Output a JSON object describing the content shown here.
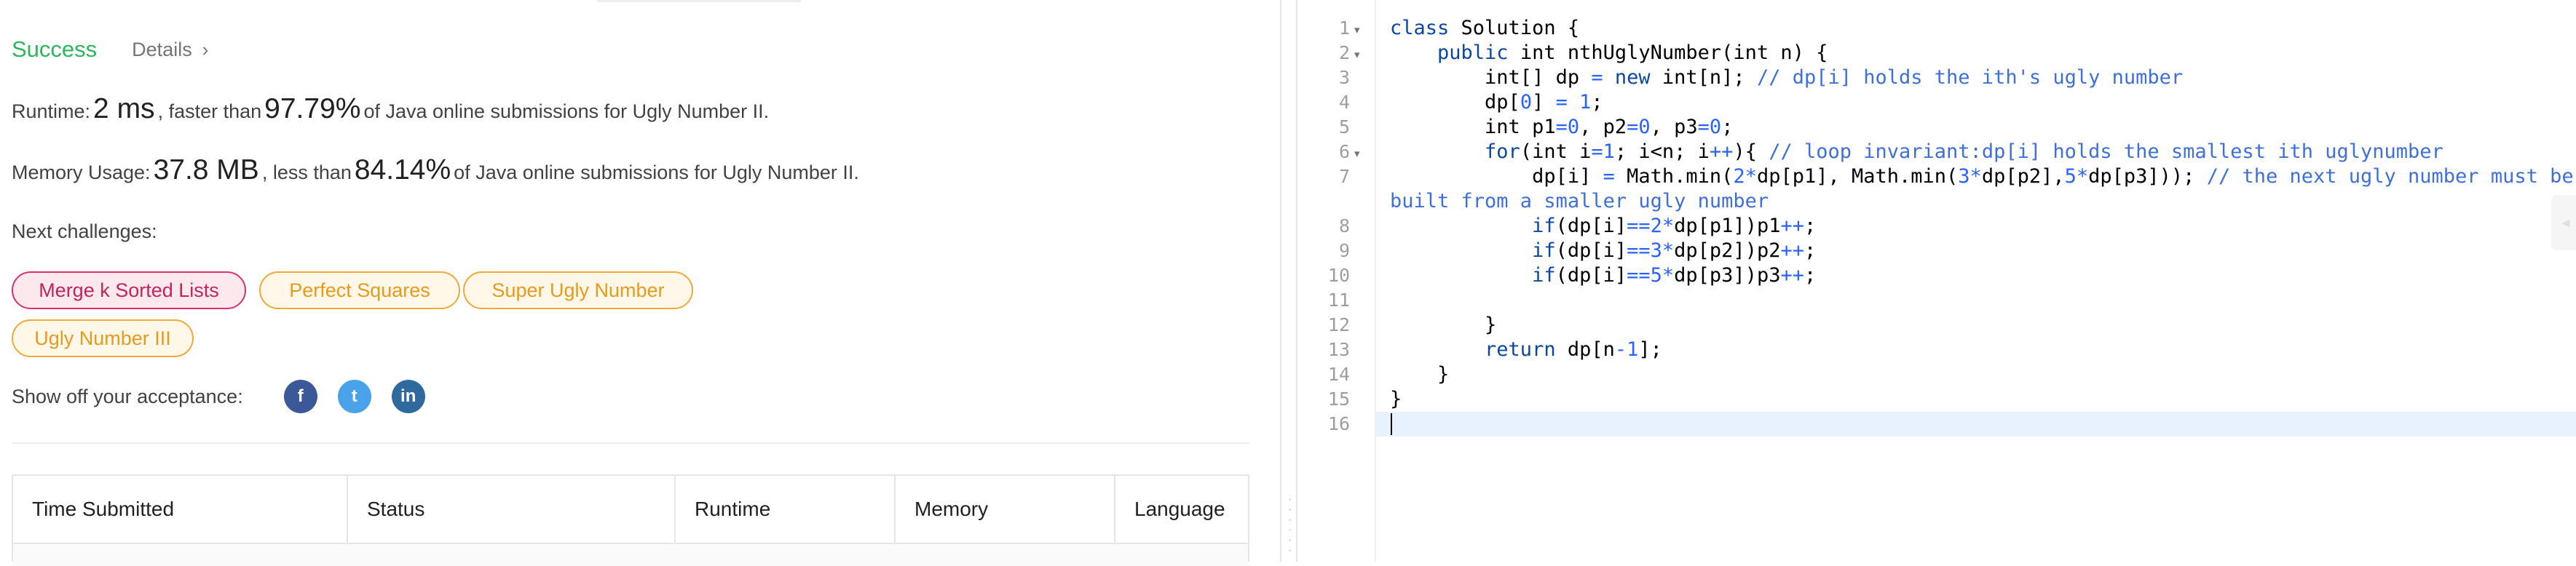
{
  "result": {
    "status": "Success",
    "details_label": "Details",
    "chevron_icon": "chevron-right-icon"
  },
  "runtime": {
    "label": "Runtime: ",
    "value": "2 ms",
    "mid": ", faster than ",
    "percent": "97.79%",
    "suffix": " of Java online submissions for Ugly Number II."
  },
  "memory": {
    "label": "Memory Usage: ",
    "value": "37.8 MB",
    "mid": ", less than ",
    "percent": "84.14%",
    "suffix": " of Java online submissions for Ugly Number II."
  },
  "next_challenges": {
    "title": "Next challenges:",
    "items": [
      {
        "label": "Merge k Sorted Lists",
        "difficulty": "hard"
      },
      {
        "label": "Perfect Squares",
        "difficulty": "medium"
      },
      {
        "label": "Super Ugly Number",
        "difficulty": "medium"
      },
      {
        "label": "Ugly Number III",
        "difficulty": "medium"
      }
    ]
  },
  "share": {
    "label": "Show off your acceptance:",
    "icons": [
      "facebook-icon",
      "twitter-icon",
      "linkedin-icon"
    ],
    "glyphs": {
      "facebook": "f",
      "twitter": "t",
      "linkedin": "in"
    }
  },
  "table": {
    "headers": [
      "Time Submitted",
      "Status",
      "Runtime",
      "Memory",
      "Language"
    ]
  },
  "editor": {
    "line_numbers": [
      "1",
      "2",
      "3",
      "4",
      "5",
      "6",
      "7",
      "8",
      "9",
      "10",
      "11",
      "12",
      "13",
      "14",
      "15",
      "16"
    ],
    "fold_markers": [
      "▾",
      "▾",
      "▾"
    ],
    "lines": {
      "l1a": "class",
      "l1b": " Solution {",
      "l2a": "    public",
      "l2b": " int nthUglyNumber(int n) {",
      "l3a": "        int[] dp ",
      "l3b": "=",
      "l3c": " new",
      "l3d": " int[n]; ",
      "l3e": "// dp[i] holds the ith's ugly number",
      "l4a": "        dp[",
      "l4b": "0",
      "l4c": "] ",
      "l4d": "=",
      "l4e": " ",
      "l4f": "1",
      "l4g": ";",
      "l5a": "        int p1",
      "l5b": "=0",
      "l5c": ", p2",
      "l5d": "=0",
      "l5e": ", p3",
      "l5f": "=0",
      "l5g": ";",
      "l6a": "        for",
      "l6b": "(int i",
      "l6c": "=1",
      "l6d": "; i<n; i",
      "l6e": "++",
      "l6f": "){ ",
      "l6g": "// loop invariant:dp[i] holds the smallest ith uglynumber",
      "l7a": "            dp[i] ",
      "l7b": "=",
      "l7c": " Math.min(",
      "l7d": "2*",
      "l7e": "dp[p1], Math.min(",
      "l7f": "3*",
      "l7g": "dp[p2],",
      "l7h": "5*",
      "l7i": "dp[p3])); ",
      "l7j": "// the next ugly number must be",
      "l7w": "built from a smaller ugly number",
      "l8a": "            if",
      "l8b": "(dp[i]",
      "l8c": "==2*",
      "l8d": "dp[p1])p1",
      "l8e": "++",
      "l8f": ";",
      "l9a": "            if",
      "l9b": "(dp[i]",
      "l9c": "==3*",
      "l9d": "dp[p2])p2",
      "l9e": "++",
      "l9f": ";",
      "l10a": "            if",
      "l10b": "(dp[i]",
      "l10c": "==5*",
      "l10d": "dp[p3])p3",
      "l10e": "++",
      "l10f": ";",
      "l12": "        }",
      "l13a": "        return",
      "l13b": " dp[n",
      "l13c": "-1",
      "l13d": "];",
      "l14": "    }",
      "l15": "}"
    }
  }
}
